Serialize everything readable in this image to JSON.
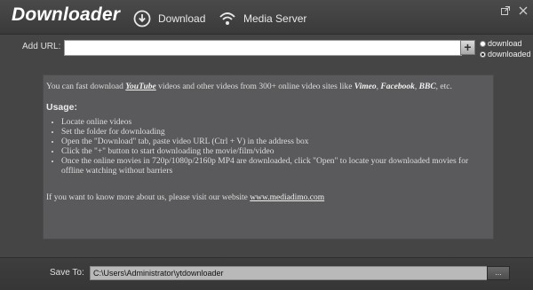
{
  "app": {
    "title": "Downloader"
  },
  "nav": {
    "download_label": "Download",
    "media_server_label": "Media Server"
  },
  "url_bar": {
    "label": "Add URL:",
    "value": "",
    "add_label": "+",
    "radio_download": "download",
    "radio_downloaded": "downloaded",
    "selected": "downloaded"
  },
  "info": {
    "intro_prefix": "You can fast download ",
    "intro_youtube": "YouTube",
    "intro_middle": " videos and other videos from 300+ online video sites like ",
    "intro_vimeo": "Vimeo",
    "intro_sep1": ", ",
    "intro_facebook": "Facebook",
    "intro_sep2": ", ",
    "intro_bbc": "BBC",
    "intro_suffix": ", etc.",
    "usage_title": "Usage:",
    "steps": [
      "Locate online videos",
      "Set the folder for downloading",
      "Open the \"Download\" tab, paste video URL (Ctrl + V) in the address box",
      "Click the \"+\" button to start downloading the movie/film/video",
      "Once the online movies in 720p/1080p/2160p MP4 are downloaded, click \"Open\" to locate your downloaded movies for offline watching without barriers"
    ],
    "more_prefix": "If you want to know more about us, please visit our website ",
    "website": "www.mediadimo.com"
  },
  "save": {
    "label": "Save To:",
    "path": "C:\\Users\\Administrator\\ytdownloader",
    "browse_label": "..."
  },
  "icons": {
    "download": "download-icon",
    "media_server": "wifi-icon",
    "external": "external-window-icon",
    "close": "close-icon"
  }
}
